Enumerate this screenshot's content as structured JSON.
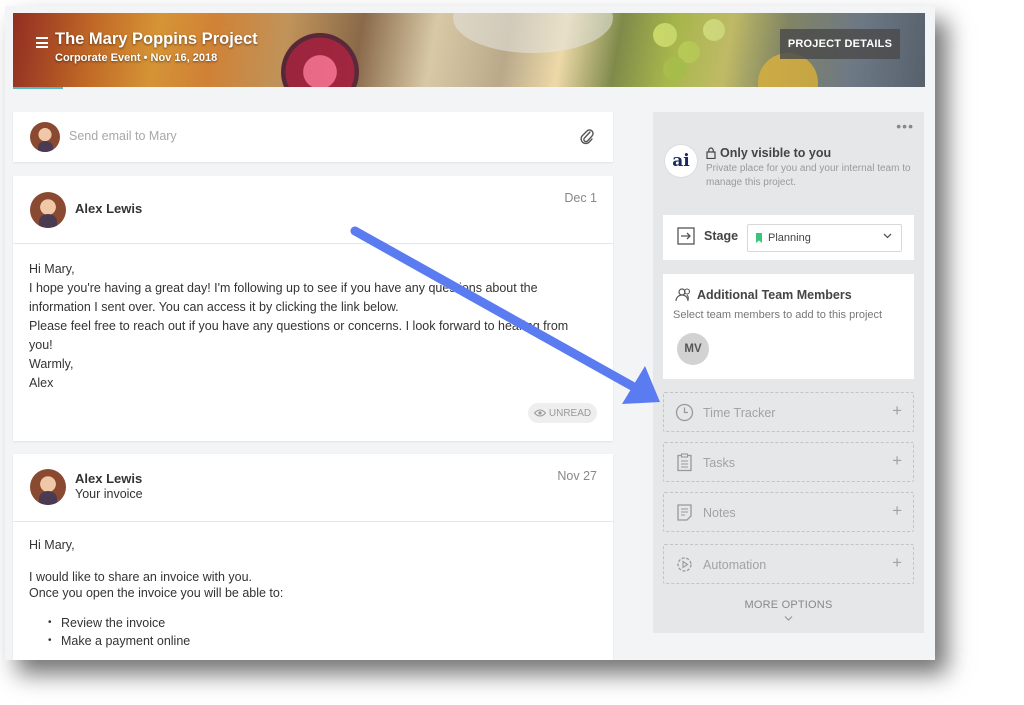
{
  "header": {
    "title": "The Mary Poppins Project",
    "subtitle": "Corporate Event • Nov 16, 2018",
    "details_button": "PROJECT DETAILS"
  },
  "compose": {
    "placeholder": "Send email to Mary"
  },
  "emails": [
    {
      "sender": "Alex Lewis",
      "date": "Dec 1",
      "lines": [
        "Hi Mary,",
        "I hope you're having a great day! I'm following up to see if you have any questions about the",
        "information I sent over. You can access it by clicking the link below.",
        "Please feel free to reach out if you have any questions or concerns. I look forward to hearing from",
        "you!",
        "Warmly,",
        "Alex"
      ],
      "status": "UNREAD"
    },
    {
      "sender": "Alex Lewis",
      "subject": "Your invoice",
      "date": "Nov 27",
      "lines": [
        "Hi Mary,",
        "I would like to share an invoice with you.",
        "Once you open the invoice you will be able to:"
      ],
      "bullets": [
        "Review the invoice",
        "Make a payment online"
      ]
    }
  ],
  "sidebar": {
    "logo_text": "ai",
    "visibility_title": "Only visible to you",
    "visibility_desc": "Private place for you and your internal team to manage this project.",
    "stage_label": "Stage",
    "stage_value": "Planning",
    "team_title": "Additional Team Members",
    "team_desc": "Select team members to add to this project",
    "member_initials": "MV",
    "tools": [
      {
        "label": "Time Tracker",
        "icon": "clock-icon"
      },
      {
        "label": "Tasks",
        "icon": "clipboard-icon"
      },
      {
        "label": "Notes",
        "icon": "notes-icon"
      },
      {
        "label": "Automation",
        "icon": "gear-play-icon"
      }
    ],
    "more_options": "MORE OPTIONS"
  },
  "colors": {
    "accent_arrow": "#5b7cf0",
    "stage_flag": "#3cc47c",
    "tab_underline": "#5ab8c4",
    "logo": "#1b2a5e"
  }
}
